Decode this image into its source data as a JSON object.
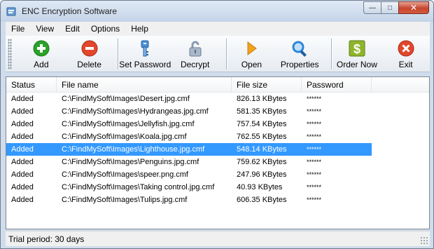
{
  "window": {
    "title": "ENC Encryption Software",
    "minimize_glyph": "—",
    "maximize_glyph": "□",
    "close_glyph": "✕"
  },
  "menu": [
    "File",
    "View",
    "Edit",
    "Options",
    "Help"
  ],
  "toolbar": {
    "add": "Add",
    "delete": "Delete",
    "set_password": "Set Password",
    "decrypt": "Decrypt",
    "open": "Open",
    "properties": "Properties",
    "order_now": "Order Now",
    "exit": "Exit"
  },
  "icons": {
    "add": "plus-circle-icon",
    "delete": "minus-circle-icon",
    "set_password": "key-icon",
    "decrypt": "padlock-open-icon",
    "open": "play-arrow-icon",
    "properties": "magnifier-icon",
    "order_now": "dollar-icon",
    "exit": "close-circle-icon"
  },
  "colors": {
    "add": "#2aa22a",
    "delete": "#e2462b",
    "key": "#4a8fd6",
    "lock": "#8a9bb0",
    "open": "#f3a21c",
    "properties": "#2e86d8",
    "order": "#8fb52a",
    "exit": "#e2462b",
    "selection": "#3399ff"
  },
  "columns": [
    "Status",
    "File name",
    "File size",
    "Password"
  ],
  "rows": [
    {
      "status": "Added",
      "file": "C:\\FindMySoft\\Images\\Desert.jpg.cmf",
      "size": "826.13 KBytes",
      "password": "******"
    },
    {
      "status": "Added",
      "file": "C:\\FindMySoft\\Images\\Hydrangeas.jpg.cmf",
      "size": "581.35 KBytes",
      "password": "******"
    },
    {
      "status": "Added",
      "file": "C:\\FindMySoft\\Images\\Jellyfish.jpg.cmf",
      "size": "757.54 KBytes",
      "password": "******"
    },
    {
      "status": "Added",
      "file": "C:\\FindMySoft\\Images\\Koala.jpg.cmf",
      "size": "762.55 KBytes",
      "password": "******"
    },
    {
      "status": "Added",
      "file": "C:\\FindMySoft\\Images\\Lighthouse.jpg.cmf",
      "size": "548.14 KBytes",
      "password": "******"
    },
    {
      "status": "Added",
      "file": "C:\\FindMySoft\\Images\\Penguins.jpg.cmf",
      "size": "759.62 KBytes",
      "password": "******"
    },
    {
      "status": "Added",
      "file": "C:\\FindMySoft\\Images\\speer.png.cmf",
      "size": "247.96 KBytes",
      "password": "******"
    },
    {
      "status": "Added",
      "file": "C:\\FindMySoft\\Images\\Taking control.jpg.cmf",
      "size": "40.93 KBytes",
      "password": "******"
    },
    {
      "status": "Added",
      "file": "C:\\FindMySoft\\Images\\Tulips.jpg.cmf",
      "size": "606.35 KBytes",
      "password": "******"
    }
  ],
  "selected_row": 4,
  "status": {
    "text": "Trial period: 30 days"
  }
}
